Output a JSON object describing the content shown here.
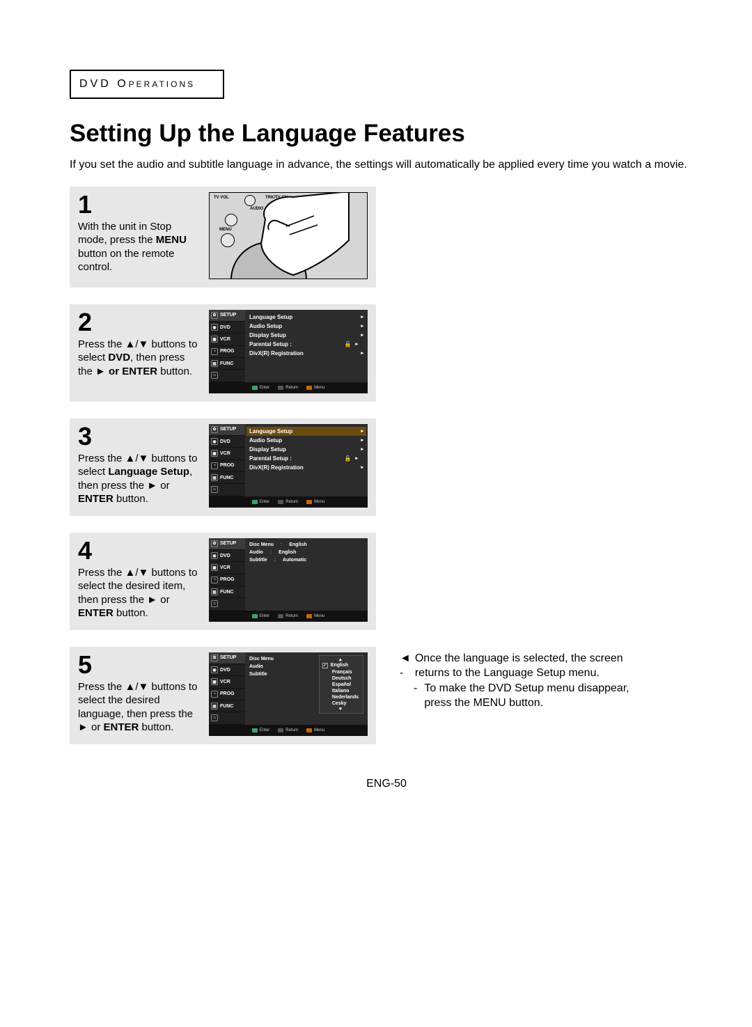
{
  "header_box": {
    "big": "DVD O",
    "small": "PERATIONS"
  },
  "title": "Setting Up the Language Features",
  "intro": "If you set the audio and subtitle language in advance, the settings will automatically be applied every time you watch a movie.",
  "steps": {
    "s1": {
      "num": "1",
      "t1": "With the unit in Stop mode, press the ",
      "b1": "MENU",
      "t2": " button on the remote control."
    },
    "s2": {
      "num": "2",
      "t1": "Press the ▲/▼ buttons to select ",
      "b1": "DVD",
      "t2": ", then press the ",
      "b2": "► or ENTER",
      "t3": " button."
    },
    "s3": {
      "num": "3",
      "t1": "Press the ▲/▼ buttons to select ",
      "b1": "Language Setup",
      "t2": ", then press the ► or ",
      "b2": "ENTER",
      "t3": " button."
    },
    "s4": {
      "num": "4",
      "t1": "Press the ▲/▼ buttons to select the desired item, then press the ► or ",
      "b1": "ENTER",
      "t2": " button."
    },
    "s5": {
      "num": "5",
      "t1": "Press the ▲/▼ buttons to select the desired language, then press the ► or ",
      "b1": "ENTER",
      "t2": " button."
    }
  },
  "remote_labels": {
    "tvvol": "TV VOL",
    "trk": "TRK/TV CH",
    "audio": "AUDIO",
    "menu": "MENU"
  },
  "side_tabs": [
    "SETUP",
    "DVD",
    "VCR",
    "PROG",
    "FUNC"
  ],
  "side_icons": [
    "✿",
    "◉",
    "▣",
    "◔",
    "▤",
    "⌂"
  ],
  "menu_setup": {
    "items": [
      "Language  Setup",
      "Audio  Setup",
      "Display  Setup",
      "Parental  Setup  :",
      "DivX(R) Registration"
    ],
    "lock": "🔓"
  },
  "menu_lang": {
    "rows": [
      {
        "k": "Disc Menu",
        "v": "English"
      },
      {
        "k": "Audio",
        "v": "English"
      },
      {
        "k": "Subtitle",
        "v": "Automatic"
      }
    ]
  },
  "menu_lang_pick": {
    "left": [
      "Disc Menu",
      "Audio",
      "Subtitle"
    ],
    "options": [
      "English",
      "Français",
      "Deutsch",
      "Español",
      "Italiano",
      "Nederlands",
      "Cesky"
    ]
  },
  "footer": {
    "enter": "Enter",
    "return": "Return",
    "menu": "Menu"
  },
  "notes": {
    "lead": "◄  -  ",
    "n1": "Once the language is selected, the screen returns to the Language Setup menu.",
    "dash": "-",
    "n2": "To make the DVD Setup menu disappear, press the MENU button."
  },
  "page_num": "ENG-50"
}
